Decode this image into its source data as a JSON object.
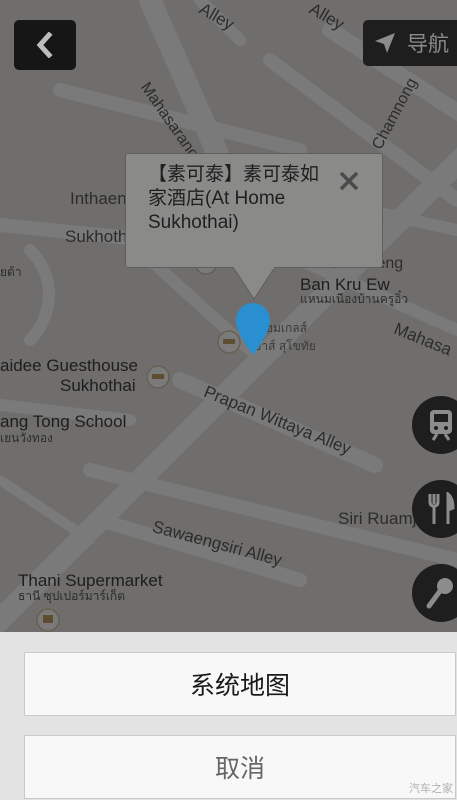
{
  "header": {
    "back_icon": "chevron-left-icon",
    "nav_icon": "navigation-arrow-icon",
    "nav_label": "导航"
  },
  "map": {
    "streets": [
      "Mahasaranon",
      "Chamnong",
      "Inthaen",
      "Sukhoth",
      "Ruean Kraeng",
      "Prapan Wittaya Alley",
      "Siri Ruamjai",
      "Sawaengsiri Alley",
      "Mahasa",
      "Alley",
      "Alley"
    ],
    "places": [
      {
        "name": "Ban Kru Ew",
        "local": "แหนมเนืองบ้านครูอิ๋ว"
      },
      {
        "name": "aidee Guesthouse",
        "line2": "Sukhothai"
      },
      {
        "name": "ang Tong School",
        "local": "เยนวังทอง"
      },
      {
        "name": "Thani Supermarket",
        "local": "ธานี ซุปเปอร์มาร์เก็ต"
      },
      {
        "name": "ยต้า"
      },
      {
        "name": "ท โฮมเกลส์",
        "local": "เฮาส์ สุโขทัย"
      }
    ]
  },
  "popup": {
    "title": "【素可泰】素可泰如家酒店(At Home Sukhothai)",
    "close_icon": "close-icon"
  },
  "poi_buttons": [
    {
      "icon": "train-icon"
    },
    {
      "icon": "restaurant-icon"
    },
    {
      "icon": "microphone-icon"
    }
  ],
  "sheet": {
    "system_map": "系统地图",
    "cancel": "取消",
    "watermark": "汽车之家"
  },
  "colors": {
    "marker": "#2a8fd0",
    "sheet_bg": "#e3e3e3"
  }
}
